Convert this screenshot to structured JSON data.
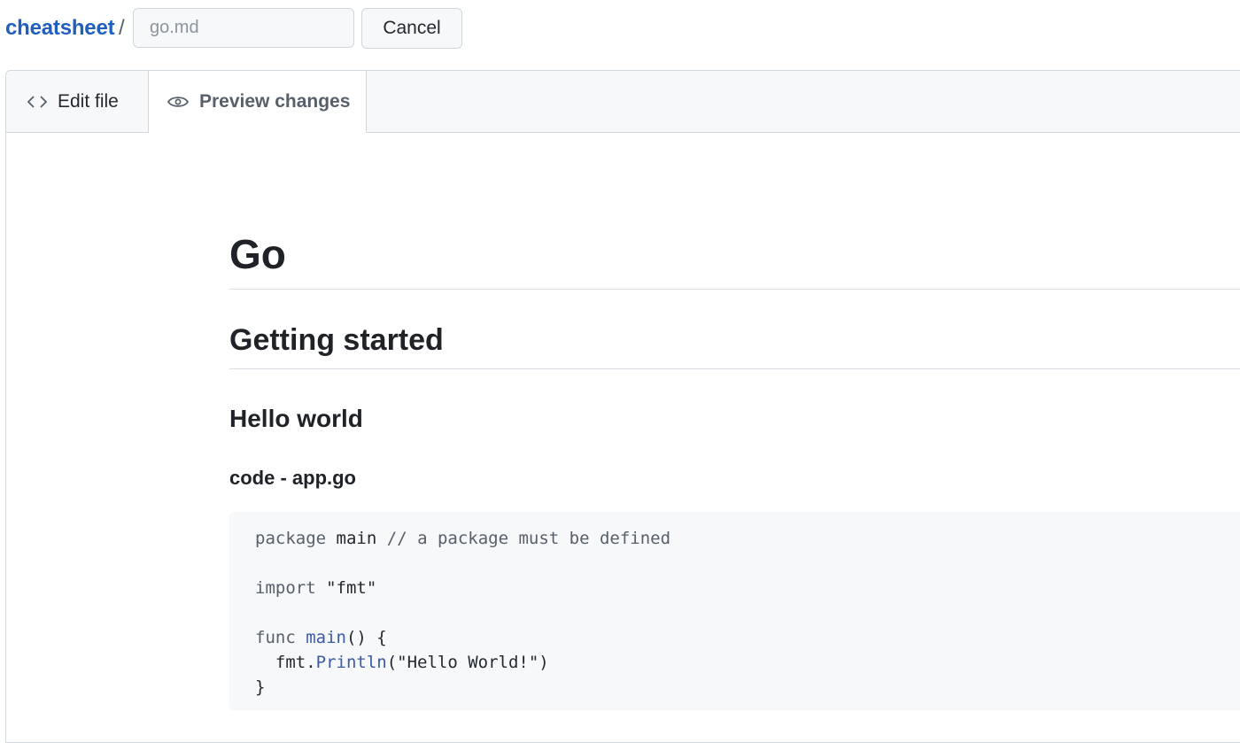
{
  "breadcrumb": {
    "repo": "cheatsheet",
    "separator": "/"
  },
  "filename_input": {
    "placeholder": "go.md",
    "value": ""
  },
  "cancel_label": "Cancel",
  "tabs": [
    {
      "label": "Edit file",
      "icon": "code-icon",
      "active": false
    },
    {
      "label": "Preview changes",
      "icon": "eye-icon",
      "active": true
    }
  ],
  "preview": {
    "h1": "Go",
    "h2": "Getting started",
    "h3": "Hello world",
    "h4": "code - app.go",
    "code": {
      "line1": {
        "kw": "package",
        "ident": "main",
        "comment": "// a package must be defined"
      },
      "line3": {
        "kw": "import",
        "str": "\"fmt\""
      },
      "line5": {
        "kw": "func",
        "fn": "main",
        "rest": "() {"
      },
      "line6": {
        "pkg": "  fmt.",
        "fn": "Println",
        "rest": "(\"Hello World!\")"
      },
      "line7": "}"
    }
  },
  "colors": {
    "link": "#1f5fbf",
    "function": "#3b5aa8",
    "code_background": "#f6f8fa"
  }
}
